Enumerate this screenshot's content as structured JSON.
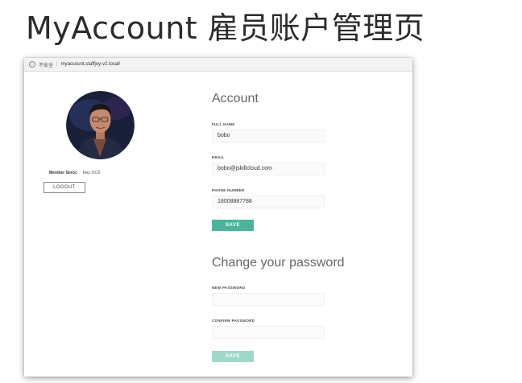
{
  "slide": {
    "title": "MyAccount 雇员账户管理页"
  },
  "browser": {
    "security_label": "不安全",
    "url": "myaccount.staffjoy-v2.local/"
  },
  "profile": {
    "member_since_label": "Member Since:",
    "member_since_value": "May 2019",
    "logout_label": "LOGOUT"
  },
  "account": {
    "title": "Account",
    "full_name_label": "FULL NAME",
    "full_name_value": "bobo",
    "email_label": "EMAIL",
    "email_value": "bobo@jskillcloud.com",
    "phone_label": "PHONE NUMBER",
    "phone_value": "18008887788",
    "save_label": "SAVE"
  },
  "password": {
    "title": "Change your password",
    "new_label": "NEW PASSWORD",
    "new_value": "",
    "confirm_label": "CONFIRM PASSWORD",
    "confirm_value": "",
    "save_label": "SAVE"
  },
  "colors": {
    "save_active": "#4db39b",
    "save_disabled": "#9fd8c8"
  }
}
